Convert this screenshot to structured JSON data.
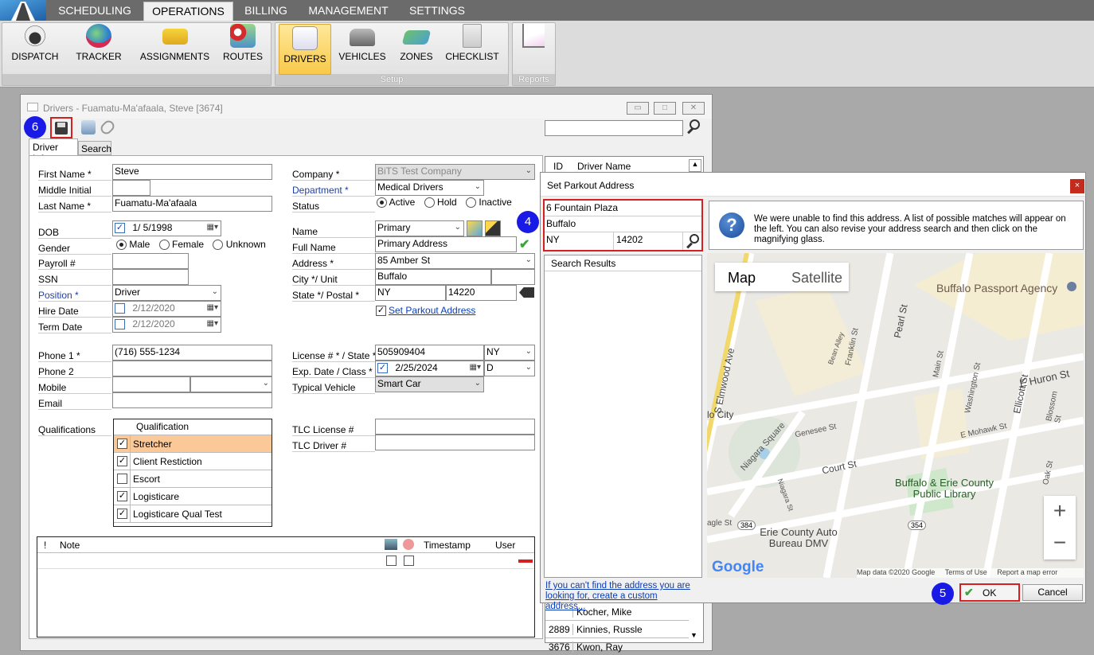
{
  "top_tabs": [
    "SCHEDULING",
    "OPERATIONS",
    "BILLING",
    "MANAGEMENT",
    "SETTINGS"
  ],
  "ribbon": {
    "buttons": [
      "DISPATCH",
      "TRACKER",
      "ASSIGNMENTS",
      "ROUTES",
      "DRIVERS",
      "VEHICLES",
      "ZONES",
      "CHECKLIST"
    ],
    "groups": {
      "setup": "Setup",
      "reports": "Reports"
    }
  },
  "window": {
    "title": "Drivers - Fuamatu-Ma'afaala, Steve [3674]"
  },
  "tabs": {
    "driver_info": "Driver Info",
    "search": "Search"
  },
  "badges": {
    "six": "6",
    "four": "4",
    "five": "5"
  },
  "form": {
    "first_name_label": "First Name *",
    "first_name": "Steve",
    "middle_initial_label": "Middle Initial",
    "last_name_label": "Last Name *",
    "last_name": "Fuamatu-Ma'afaala",
    "dob_label": "DOB",
    "dob": "1/ 5/1998",
    "gender_label": "Gender",
    "gender_options": [
      "Male",
      "Female",
      "Unknown"
    ],
    "payroll_label": "Payroll #",
    "ssn_label": "SSN",
    "position_label": "Position *",
    "position": "Driver",
    "hire_date_label": "Hire Date",
    "hire_date": "2/12/2020",
    "term_date_label": "Term Date",
    "term_date": "2/12/2020",
    "company_label": "Company *",
    "company": "BiTS Test Company",
    "department_label": "Department *",
    "department": "Medical Drivers",
    "status_label": "Status",
    "status_options": [
      "Active",
      "Hold",
      "Inactive"
    ],
    "name_label": "Name",
    "name": "Primary",
    "full_name_label": "Full Name",
    "full_name": "Primary Address",
    "address_label": "Address *",
    "address": "85 Amber St",
    "city_label": "City */ Unit",
    "city": "Buffalo",
    "state_label": "State */ Postal *",
    "state": "NY",
    "postal": "14220",
    "set_parkout": "Set Parkout Address",
    "phone1_label": "Phone 1 *",
    "phone1": "(716) 555-1234",
    "phone2_label": "Phone 2",
    "mobile_label": "Mobile",
    "email_label": "Email",
    "license_label": "License # * / State *",
    "license": "505909404",
    "license_state": "NY",
    "exp_label": "Exp. Date / Class *",
    "exp_date": "2/25/2024",
    "license_class": "D",
    "vehicle_label": "Typical Vehicle",
    "vehicle": "Smart Car",
    "qualifications_label": "Qualifications",
    "qual_header": "Qualification",
    "qualifications": [
      {
        "name": "Stretcher",
        "checked": true
      },
      {
        "name": "Client Restiction",
        "checked": true
      },
      {
        "name": "Escort",
        "checked": false
      },
      {
        "name": "Logisticare",
        "checked": true
      },
      {
        "name": "Logisticare Qual Test",
        "checked": true
      }
    ],
    "tlc_license_label": "TLC License #",
    "tlc_driver_label": "TLC Driver #"
  },
  "notes": {
    "bang": "!",
    "note": "Note",
    "timestamp": "Timestamp",
    "user": "User"
  },
  "driver_list": {
    "col_id": "ID",
    "col_name": "Driver Name",
    "rows": [
      {
        "id": "",
        "name": "Kocher, Mike"
      },
      {
        "id": "2889",
        "name": "Kinnies, Russle"
      },
      {
        "id": "3676",
        "name": "Kwon, Ray"
      }
    ]
  },
  "dialog": {
    "title": "Set Parkout Address",
    "street": "6 Fountain Plaza",
    "city": "Buffalo",
    "state": "NY",
    "zip": "14202",
    "message": "We were unable to find this address. A list of possible matches will appear on the left. You can also revise your address search and then click on the magnifying glass.",
    "search_results": "Search Results",
    "custom_link": "If you can't find the address you are looking for, create a custom address...",
    "ok": "OK",
    "cancel": "Cancel"
  },
  "map": {
    "map_btn": "Map",
    "satellite_btn": "Satellite",
    "labels": [
      "Buffalo Passport Agency",
      "S Elmwood Ave",
      "Pearl St",
      "Main St",
      "Washington St",
      "Ellicott St",
      "E Huron St",
      "Blossom St",
      "E Mohawk St",
      "Genesee St",
      "Franklin St",
      "Bean Alley",
      "Niagara Square",
      "Niagara St",
      "Court St",
      "Oak St",
      "Buffalo & Erie County Public Library",
      "Erie County Auto Bureau DMV",
      "lo City",
      "agle St",
      "384",
      "354"
    ],
    "google": "Google",
    "attribution": [
      "Map data ©2020 Google",
      "Terms of Use",
      "Report a map error"
    ],
    "zoom_in": "+",
    "zoom_out": "−"
  }
}
